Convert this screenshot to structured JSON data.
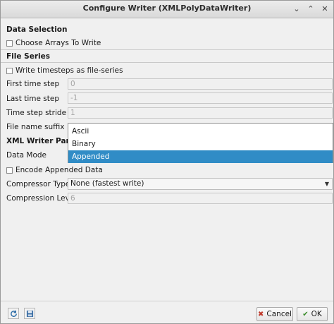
{
  "window": {
    "title": "Configure Writer (XMLPolyDataWriter)"
  },
  "data_selection": {
    "heading": "Data Selection",
    "choose_arrays_label": "Choose Arrays To Write",
    "choose_arrays_checked": false
  },
  "file_series": {
    "heading": "File Series",
    "write_timesteps_label": "Write timesteps as file-series",
    "write_timesteps_checked": false,
    "first_time_step_label": "First time step",
    "first_time_step_value": "0",
    "last_time_step_label": "Last time step",
    "last_time_step_value": "-1",
    "stride_label": "Time step stride",
    "stride_value": "1",
    "suffix_label": "File name suffix"
  },
  "xml_writer": {
    "heading": "XML Writer Parame",
    "data_mode_label": "Data Mode",
    "data_mode_options": [
      "Ascii",
      "Binary",
      "Appended"
    ],
    "data_mode_selected": "Appended",
    "encode_appended_label": "Encode Appended Data",
    "encode_appended_checked": false,
    "compressor_type_label": "Compressor Type",
    "compressor_type_value": "None (fastest write)",
    "compression_level_label": "Compression Level",
    "compression_level_value": "6"
  },
  "footer": {
    "cancel_label": "Cancel",
    "ok_label": "OK",
    "reset_icon": "refresh-icon",
    "save_icon": "save-icon"
  },
  "colors": {
    "selection": "#308cc6",
    "background": "#f0f0f0"
  }
}
